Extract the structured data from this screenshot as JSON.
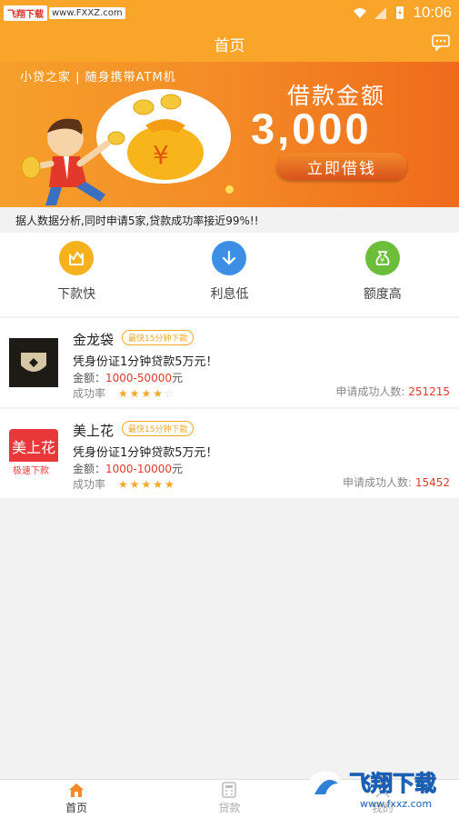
{
  "status_bar": {
    "watermark_badge": "飞翔下载",
    "watermark_url": "www.FXXZ.com",
    "time": "10:06"
  },
  "nav": {
    "title": "首页"
  },
  "banner": {
    "tag": "小贷之家 | 随身携带ATM机",
    "heading": "借款金额",
    "amount": "3,000",
    "button": "立即借钱"
  },
  "notice": {
    "text": "据人数据分析,同时申请5家,贷款成功率接近99%!!"
  },
  "features": [
    {
      "label": "下款快",
      "icon": "chart-icon",
      "color": "#f5b21d"
    },
    {
      "label": "利息低",
      "icon": "arrow-down-icon",
      "color": "#3d8fe5"
    },
    {
      "label": "额度高",
      "icon": "money-bag-icon",
      "color": "#6bbd3a"
    }
  ],
  "products": [
    {
      "name": "金龙袋",
      "badge": "最快15分钟下款",
      "desc": "凭身份证1分钟贷款5万元！",
      "amount_label": "金额：",
      "amount_value": "1000-50000",
      "amount_unit": "元",
      "rate_label": "成功率",
      "stars": 4,
      "applicants_label": "申请成功人数:",
      "applicants_value": "251215"
    },
    {
      "name": "美上花",
      "badge": "最快15分钟下款",
      "desc": "凭身份证1分钟贷款5万元！",
      "amount_label": "金额：",
      "amount_value": "1000-10000",
      "amount_unit": "元",
      "rate_label": "成功率",
      "stars": 5,
      "applicants_label": "申请成功人数:",
      "applicants_value": "15452",
      "logo_text_top": "美上花",
      "logo_text_bottom": "极速下款"
    }
  ],
  "tabs": [
    {
      "label": "首页",
      "icon": "home-icon",
      "active": true
    },
    {
      "label": "贷款",
      "icon": "calculator-icon",
      "active": false
    },
    {
      "label": "我的",
      "icon": "user-icon",
      "active": false
    }
  ],
  "watermark_logo": {
    "text": "飞翔下载",
    "url": "www.fxxz.com"
  },
  "colors": {
    "primary": "#f9a52a",
    "accent_red": "#e03a2a",
    "star": "#f5a623"
  }
}
